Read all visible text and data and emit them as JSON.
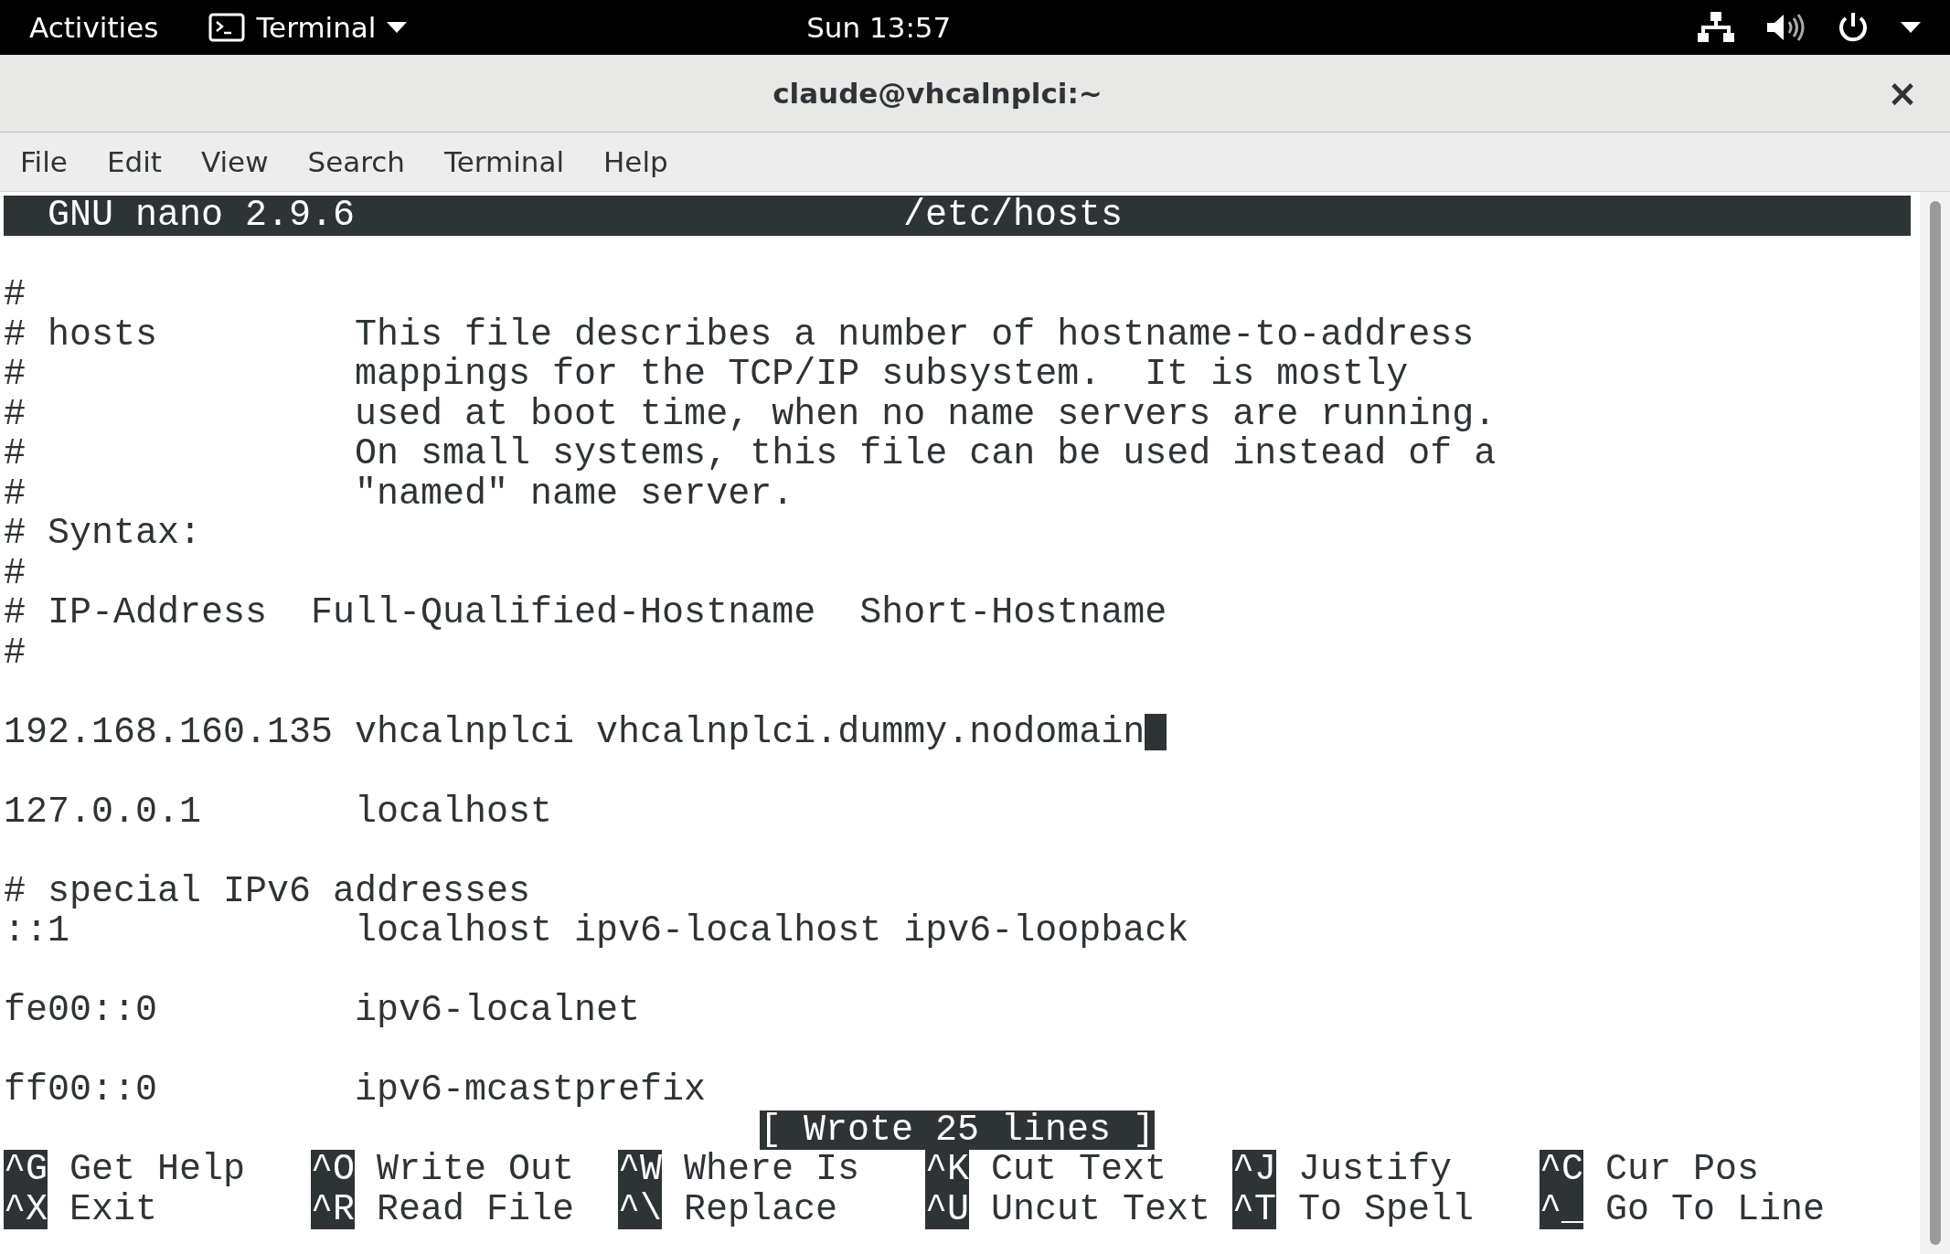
{
  "top_bar": {
    "activities": "Activities",
    "app_menu": "Terminal",
    "clock": "Sun 13:57"
  },
  "window": {
    "title": "claude@vhcalnplci:~",
    "close": "×"
  },
  "menu": [
    "File",
    "Edit",
    "View",
    "Search",
    "Terminal",
    "Help"
  ],
  "nano": {
    "version": "GNU nano 2.9.6",
    "file": "/etc/hosts",
    "lines": [
      {
        "kind": "blank"
      },
      {
        "kind": "text",
        "text": "#",
        "cursor": false
      },
      {
        "kind": "text",
        "text": "# hosts         This file describes a number of hostname-to-address",
        "cursor": false
      },
      {
        "kind": "text",
        "text": "#               mappings for the TCP/IP subsystem.  It is mostly",
        "cursor": false
      },
      {
        "kind": "text",
        "text": "#               used at boot time, when no name servers are running.",
        "cursor": false
      },
      {
        "kind": "text",
        "text": "#               On small systems, this file can be used instead of a",
        "cursor": false
      },
      {
        "kind": "text",
        "text": "#               \"named\" name server.",
        "cursor": false
      },
      {
        "kind": "text",
        "text": "# Syntax:",
        "cursor": false
      },
      {
        "kind": "text",
        "text": "#",
        "cursor": false
      },
      {
        "kind": "text",
        "text": "# IP-Address  Full-Qualified-Hostname  Short-Hostname",
        "cursor": false
      },
      {
        "kind": "text",
        "text": "#",
        "cursor": false
      },
      {
        "kind": "blank"
      },
      {
        "kind": "text",
        "text": "192.168.160.135 vhcalnplci vhcalnplci.dummy.nodomain",
        "cursor": true
      },
      {
        "kind": "blank"
      },
      {
        "kind": "text",
        "text": "127.0.0.1       localhost",
        "cursor": false
      },
      {
        "kind": "blank"
      },
      {
        "kind": "text",
        "text": "# special IPv6 addresses",
        "cursor": false
      },
      {
        "kind": "text",
        "text": "::1             localhost ipv6-localhost ipv6-loopback",
        "cursor": false
      },
      {
        "kind": "blank"
      },
      {
        "kind": "text",
        "text": "fe00::0         ipv6-localnet",
        "cursor": false
      },
      {
        "kind": "blank"
      },
      {
        "kind": "text",
        "text": "ff00::0         ipv6-mcastprefix",
        "cursor": false
      }
    ],
    "status": "[ Wrote 25 lines ]",
    "shortcuts": [
      [
        {
          "key": "^G",
          "label": "Get Help"
        },
        {
          "key": "^O",
          "label": "Write Out"
        },
        {
          "key": "^W",
          "label": "Where Is"
        },
        {
          "key": "^K",
          "label": "Cut Text"
        },
        {
          "key": "^J",
          "label": "Justify"
        },
        {
          "key": "^C",
          "label": "Cur Pos"
        }
      ],
      [
        {
          "key": "^X",
          "label": "Exit"
        },
        {
          "key": "^R",
          "label": "Read File"
        },
        {
          "key": "^\\",
          "label": "Replace"
        },
        {
          "key": "^U",
          "label": "Uncut Text"
        },
        {
          "key": "^T",
          "label": "To Spell"
        },
        {
          "key": "^_",
          "label": "Go To Line"
        }
      ]
    ]
  }
}
